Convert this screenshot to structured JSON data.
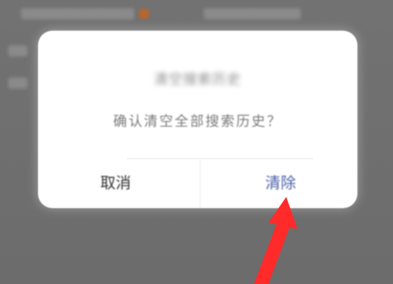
{
  "dialog": {
    "title": "清空搜索历史",
    "message": "确认清空全部搜索历史？",
    "cancel_label": "取消",
    "confirm_label": "清除"
  },
  "colors": {
    "overlay": "#6f6f6f",
    "dialog_bg": "#ffffff",
    "confirm_text": "#4a5fa8",
    "cancel_text": "#333333",
    "annotation_arrow": "#ff2a2a"
  },
  "annotation": {
    "icon": "red-arrow-icon"
  }
}
